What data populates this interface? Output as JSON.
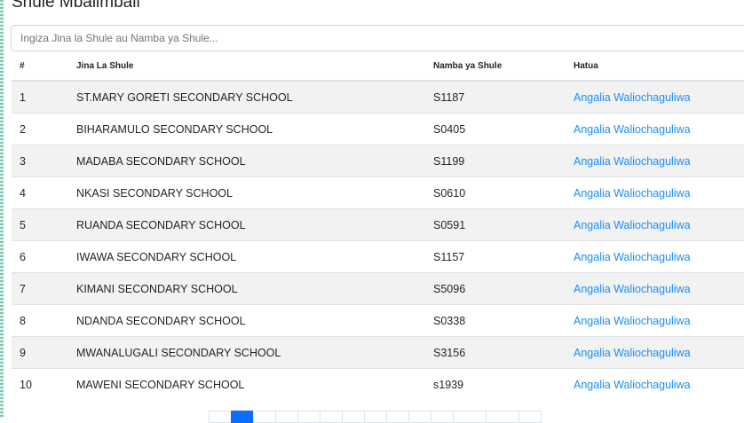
{
  "page": {
    "title": "Shule Mbalimbali"
  },
  "search": {
    "placeholder": "Ingiza Jina la Shule au Namba ya Shule..."
  },
  "table": {
    "headers": [
      "#",
      "Jina La Shule",
      "Namba ya Shule",
      "Hatua"
    ],
    "rows": [
      {
        "num": "1",
        "name": "ST.MARY GORETI SECONDARY SCHOOL",
        "code": "S1187",
        "action": "Angalia Waliochaguliwa"
      },
      {
        "num": "2",
        "name": "BIHARAMULO SECONDARY SCHOOL",
        "code": "S0405",
        "action": "Angalia Waliochaguliwa"
      },
      {
        "num": "3",
        "name": "MADABA SECONDARY SCHOOL",
        "code": "S1199",
        "action": "Angalia Waliochaguliwa"
      },
      {
        "num": "4",
        "name": "NKASI SECONDARY SCHOOL",
        "code": "S0610",
        "action": "Angalia Waliochaguliwa"
      },
      {
        "num": "5",
        "name": "RUANDA SECONDARY SCHOOL",
        "code": "S0591",
        "action": "Angalia Waliochaguliwa"
      },
      {
        "num": "6",
        "name": "IWAWA SECONDARY SCHOOL",
        "code": "S1157",
        "action": "Angalia Waliochaguliwa"
      },
      {
        "num": "7",
        "name": "KIMANI SECONDARY SCHOOL",
        "code": "S5096",
        "action": "Angalia Waliochaguliwa"
      },
      {
        "num": "8",
        "name": "NDANDA SECONDARY SCHOOL",
        "code": "S0338",
        "action": "Angalia Waliochaguliwa"
      },
      {
        "num": "9",
        "name": "MWANALUGALI SECONDARY SCHOOL",
        "code": "S3156",
        "action": "Angalia Waliochaguliwa"
      },
      {
        "num": "10",
        "name": "MAWENI SECONDARY SCHOOL",
        "code": "s1939",
        "action": "Angalia Waliochaguliwa"
      }
    ]
  },
  "colors": {
    "link": "#1a8cff",
    "stripe": "#f2f2f2",
    "active_page": "#0d6efd"
  }
}
